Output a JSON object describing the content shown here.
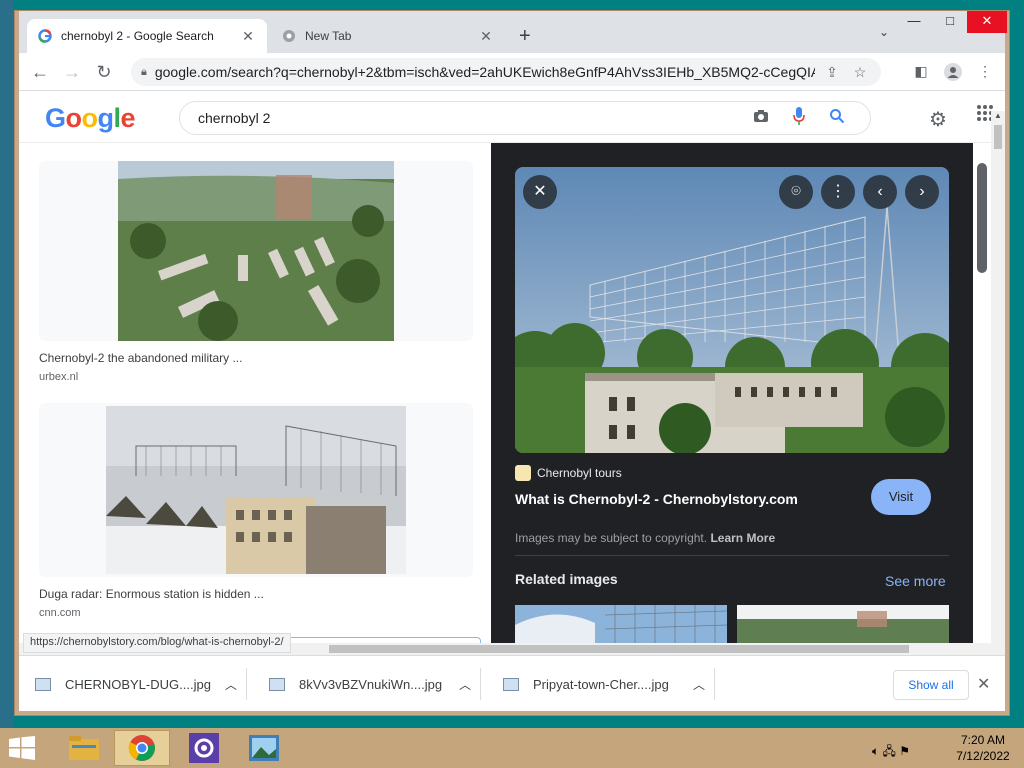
{
  "window": {
    "tabs": [
      {
        "title": "chernobyl 2 - Google Search",
        "active": true,
        "favicon": "google-g-icon"
      },
      {
        "title": "New Tab",
        "active": false,
        "favicon": "chrome-icon"
      }
    ],
    "controls": {
      "minimize": "—",
      "maximize": "□",
      "close": "✕"
    }
  },
  "toolbar": {
    "url": "google.com/search?q=chernobyl+2&tbm=isch&ved=2ahUKEwich8eGnfP4AhVss3IEHb_XB5MQ2-cCegQIA..."
  },
  "google": {
    "logo": [
      "G",
      "o",
      "o",
      "g",
      "l",
      "e"
    ],
    "query": "chernobyl 2"
  },
  "results": [
    {
      "caption": "Chernobyl-2 the abandoned military ...",
      "source": "urbex.nl"
    },
    {
      "caption": "Duga radar: Enormous station is hidden ...",
      "source": "cnn.com"
    }
  ],
  "preview": {
    "source_name": "Chernobyl tours",
    "title": "What is Chernobyl-2 - Chernobylstory.com",
    "visit_label": "Visit",
    "copyright_text": "Images may be subject to copyright.",
    "learn_more": "Learn More",
    "related_heading": "Related images",
    "see_more": "See more"
  },
  "status_url": "https://chernobylstory.com/blog/what-is-chernobyl-2/",
  "downloads": {
    "items": [
      {
        "name": "CHERNOBYL-DUG....jpg"
      },
      {
        "name": "8kVv3vBZVnukiWn....jpg"
      },
      {
        "name": "Pripyat-town-Cher....jpg"
      }
    ],
    "show_all": "Show all"
  },
  "taskbar": {
    "time": "7:20 AM",
    "date": "7/12/2022"
  },
  "colors": {
    "accent": "#1a73e8",
    "preview_bg": "#202124",
    "visit_button": "#8ab4f8"
  }
}
